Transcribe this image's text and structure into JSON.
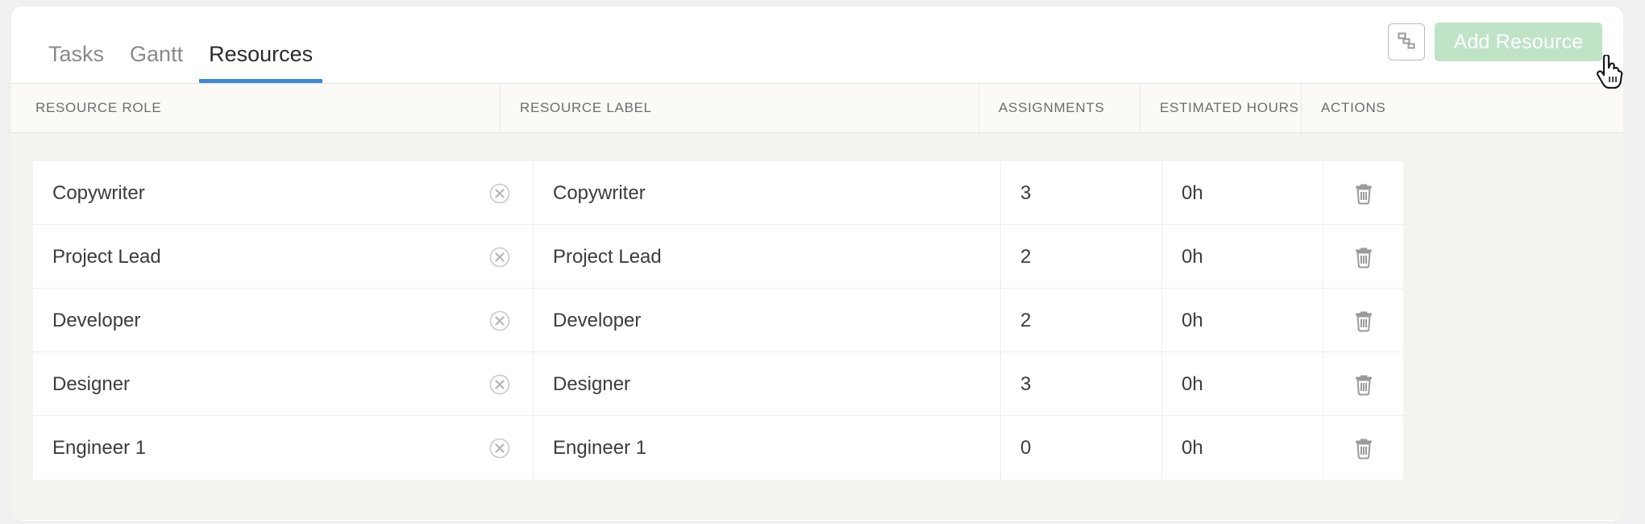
{
  "tabs": [
    {
      "label": "Tasks",
      "active": false
    },
    {
      "label": "Gantt",
      "active": false
    },
    {
      "label": "Resources",
      "active": true
    }
  ],
  "toolbar": {
    "gantt_view_icon": "cascade-squares-icon",
    "add_resource_label": "Add Resource",
    "add_resource_color": "#bfe3c6",
    "accent_color": "#3d87d4"
  },
  "table": {
    "columns": [
      {
        "key": "role",
        "label": "RESOURCE ROLE"
      },
      {
        "key": "label",
        "label": "RESOURCE LABEL"
      },
      {
        "key": "assign",
        "label": "ASSIGNMENTS"
      },
      {
        "key": "hours",
        "label": "ESTIMATED HOURS"
      },
      {
        "key": "act",
        "label": "ACTIONS"
      }
    ],
    "rows": [
      {
        "role": "Copywriter",
        "label": "Copywriter",
        "assignments": "3",
        "hours": "0h"
      },
      {
        "role": "Project Lead",
        "label": "Project Lead",
        "assignments": "2",
        "hours": "0h"
      },
      {
        "role": "Developer",
        "label": "Developer",
        "assignments": "2",
        "hours": "0h"
      },
      {
        "role": "Designer",
        "label": "Designer",
        "assignments": "3",
        "hours": "0h"
      },
      {
        "role": "Engineer 1",
        "label": "Engineer 1",
        "assignments": "0",
        "hours": "0h"
      }
    ],
    "row_clear_icon": "clear-circle-x-icon",
    "row_delete_icon": "trash-icon"
  },
  "cursor": {
    "type": "pointer-hand-cursor"
  }
}
